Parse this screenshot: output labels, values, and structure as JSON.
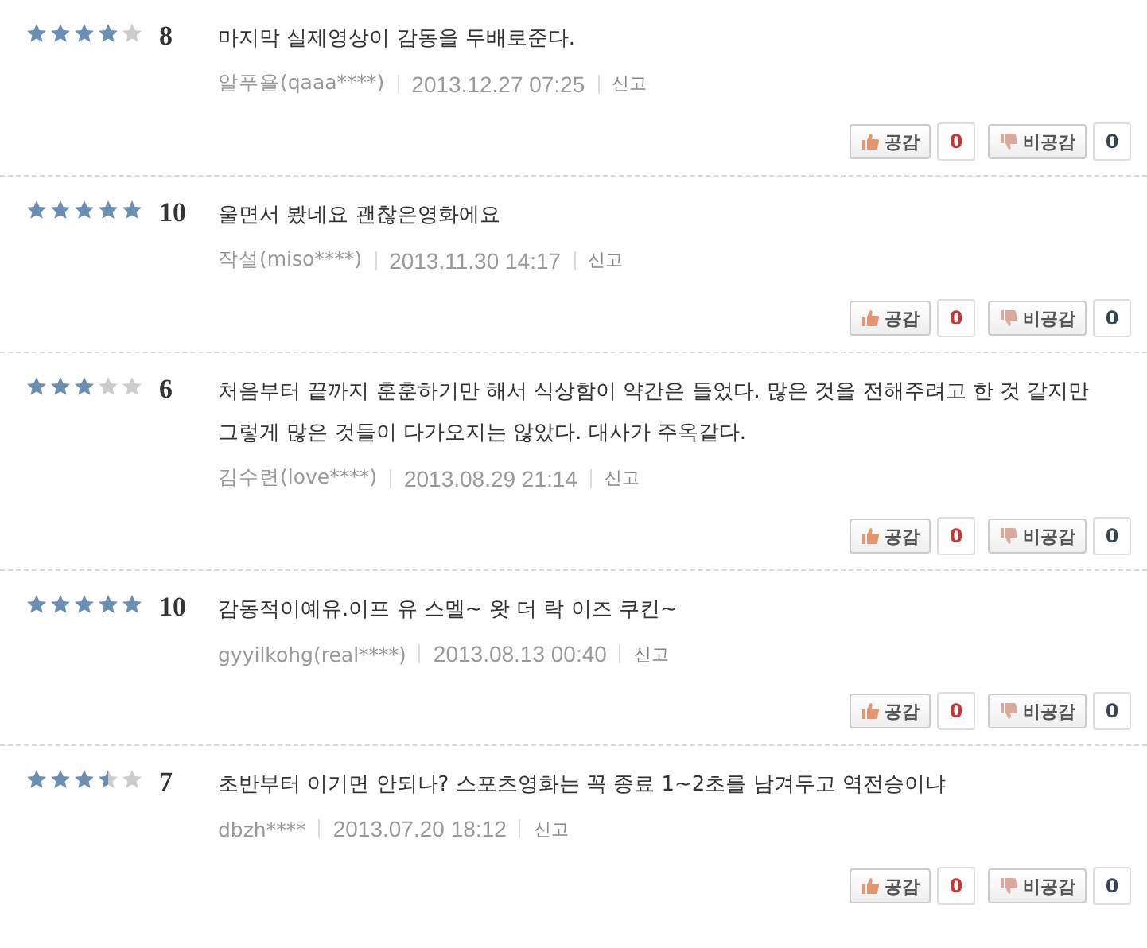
{
  "reviews": [
    {
      "stars": 4,
      "score": "8",
      "text": "마지막 실제영상이 감동을 두배로준다.",
      "author": "알푸욜(qaaa****)",
      "date": "2013.12.27 07:25",
      "report": "신고",
      "like_label": "공감",
      "like_count": "0",
      "dislike_label": "비공감",
      "dislike_count": "0"
    },
    {
      "stars": 5,
      "score": "10",
      "text": "울면서 봤네요 괜찮은영화에요",
      "author": "작설(miso****)",
      "date": "2013.11.30 14:17",
      "report": "신고",
      "like_label": "공감",
      "like_count": "0",
      "dislike_label": "비공감",
      "dislike_count": "0"
    },
    {
      "stars": 3,
      "score": "6",
      "text": "처음부터 끝까지 훈훈하기만 해서 식상함이 약간은 들었다. 많은 것을 전해주려고 한 것 같지만 그렇게 많은 것들이 다가오지는 않았다. 대사가 주옥같다.",
      "author": "김수련(love****)",
      "date": "2013.08.29 21:14",
      "report": "신고",
      "like_label": "공감",
      "like_count": "0",
      "dislike_label": "비공감",
      "dislike_count": "0"
    },
    {
      "stars": 5,
      "score": "10",
      "text": "감동적이예유.이프 유 스멜~ 왓 더 락 이즈 쿠킨~",
      "author": "gyyilkohg(real****)",
      "date": "2013.08.13 00:40",
      "report": "신고",
      "like_label": "공감",
      "like_count": "0",
      "dislike_label": "비공감",
      "dislike_count": "0"
    },
    {
      "stars": 3.5,
      "score": "7",
      "text": "초반부터 이기면 안되나? 스포츠영화는 꼭 종료 1~2초를 남겨두고 역전승이냐",
      "author": "dbzh****",
      "date": "2013.07.20 18:12",
      "report": "신고",
      "like_label": "공감",
      "like_count": "0",
      "dislike_label": "비공감",
      "dislike_count": "0"
    }
  ]
}
